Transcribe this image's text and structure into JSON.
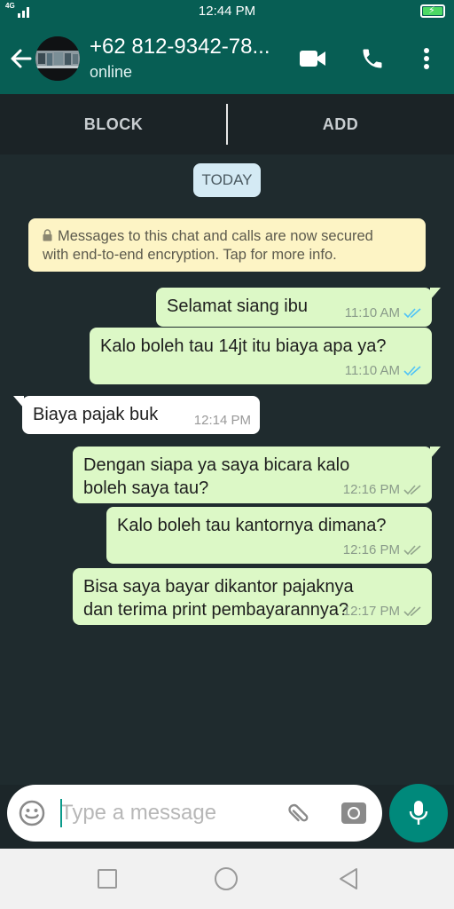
{
  "status_bar": {
    "network": "4G",
    "time": "12:44 PM"
  },
  "header": {
    "contact_name": "+62 812-9342-78...",
    "contact_status": "online",
    "icons": {
      "back": "arrow-left-icon",
      "video": "video-camera-icon",
      "call": "phone-icon",
      "menu": "more-vert-icon"
    }
  },
  "actions": {
    "block_label": "BLOCK",
    "add_label": "ADD"
  },
  "chat": {
    "date_chip": "TODAY",
    "encryption_line1": "Messages to this chat and calls are now secured",
    "encryption_line2": "with end-to-end encryption. Tap for more info.",
    "messages": [
      {
        "direction": "out",
        "lines": [
          "Selamat siang ibu"
        ],
        "time": "11:10 AM",
        "status": "read"
      },
      {
        "direction": "out",
        "lines": [
          "Kalo boleh tau 14jt itu biaya apa ya?"
        ],
        "time": "11:10 AM",
        "status": "read"
      },
      {
        "direction": "in",
        "lines": [
          "Biaya pajak buk"
        ],
        "time": "12:14 PM"
      },
      {
        "direction": "out",
        "lines": [
          "Dengan siapa ya saya bicara kalo",
          "boleh saya tau?"
        ],
        "time": "12:16 PM",
        "status": "delivered"
      },
      {
        "direction": "out",
        "lines": [
          "Kalo boleh tau kantornya dimana?"
        ],
        "time": "12:16 PM",
        "status": "delivered"
      },
      {
        "direction": "out",
        "lines": [
          "Bisa saya bayar dikantor pajaknya",
          "dan terima print pembayarannya?"
        ],
        "time": "12:17 PM",
        "status": "delivered"
      }
    ]
  },
  "composer": {
    "placeholder": "Type a message",
    "value": ""
  },
  "colors": {
    "header": "#075e54",
    "outgoing": "#dcf8c6",
    "incoming": "#ffffff",
    "read_tick": "#4fc3f7",
    "delivered_tick": "#92a58c",
    "accent": "#00897b"
  }
}
